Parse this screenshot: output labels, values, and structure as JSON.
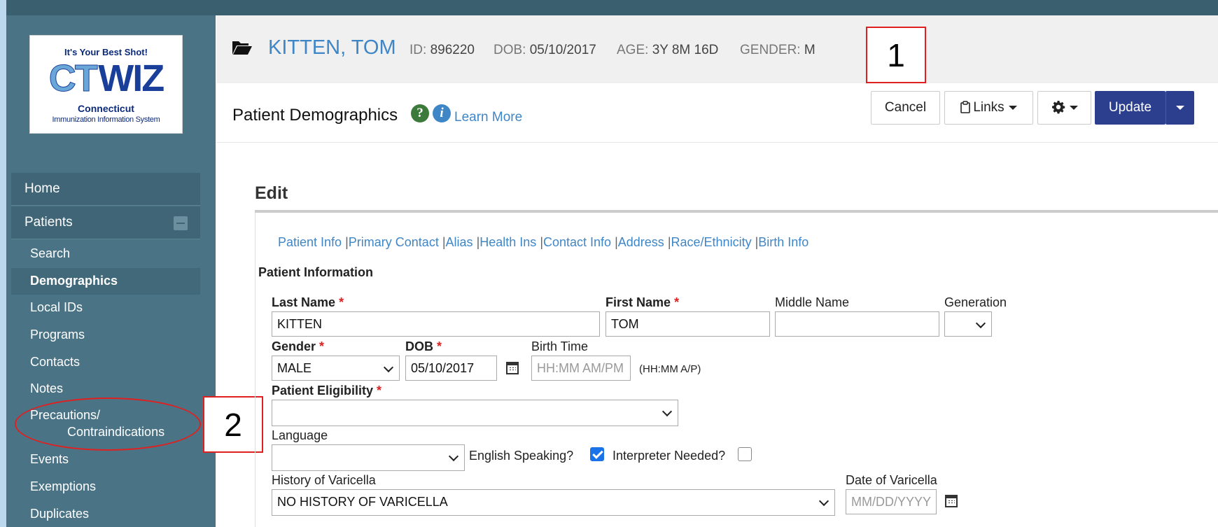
{
  "sidebar": {
    "logo": {
      "tagline": "It's Your Best Shot!",
      "brand_ct": "CT",
      "brand_wiz": "WIZ",
      "state": "Connecticut",
      "system": "Immunization Information System"
    },
    "home": "Home",
    "patients": "Patients",
    "items": [
      "Search",
      "Demographics",
      "Local IDs",
      "Programs",
      "Contacts",
      "Notes",
      "Precautions/",
      "Contraindications",
      "Events",
      "Exemptions",
      "Duplicates"
    ]
  },
  "annotations": {
    "one": "1",
    "two": "2"
  },
  "patient": {
    "name": "KITTEN, TOM",
    "id_label": "ID:",
    "id": "896220",
    "dob_label": "DOB:",
    "dob": "05/10/2017",
    "age_label": "AGE:",
    "age": "3Y 8M 16D",
    "gender_label": "GENDER:",
    "gender": "M"
  },
  "page": {
    "title": "Patient Demographics",
    "learn_more": "Learn More",
    "help_glyph": "?",
    "info_glyph": "i"
  },
  "toolbar": {
    "cancel": "Cancel",
    "links": "Links",
    "update": "Update"
  },
  "edit": {
    "title": "Edit",
    "section_links": [
      "Patient Info",
      "Primary Contact",
      "Alias",
      "Health Ins",
      "Contact Info",
      "Address",
      "Race/Ethnicity",
      "Birth Info"
    ],
    "separator": "|",
    "section_title": "Patient Information"
  },
  "form": {
    "last_name": {
      "label": "Last Name",
      "value": "KITTEN"
    },
    "first_name": {
      "label": "First Name",
      "value": "TOM"
    },
    "middle_name": {
      "label": "Middle Name",
      "value": ""
    },
    "generation": {
      "label": "Generation",
      "value": ""
    },
    "gender": {
      "label": "Gender",
      "value": "MALE"
    },
    "dob": {
      "label": "DOB",
      "value": "05/10/2017"
    },
    "birth_time": {
      "label": "Birth Time",
      "placeholder": "HH:MM AM/PM",
      "hint": "(HH:MM A/P)"
    },
    "eligibility": {
      "label": "Patient Eligibility",
      "value": ""
    },
    "language": {
      "label": "Language",
      "value": ""
    },
    "english_speaking": {
      "label": "English Speaking?",
      "checked": true
    },
    "interpreter_needed": {
      "label": "Interpreter Needed?",
      "checked": false
    },
    "varicella_history": {
      "label": "History of Varicella",
      "value": "NO HISTORY OF VARICELLA"
    },
    "varicella_date": {
      "label": "Date of Varicella",
      "placeholder": "MM/DD/YYYY"
    },
    "required_mark": "*"
  },
  "colors": {
    "accent": "#3f86c7",
    "sidebar": "#4a7486",
    "primary_button": "#2c3f8e",
    "annotation": "#e02020"
  }
}
